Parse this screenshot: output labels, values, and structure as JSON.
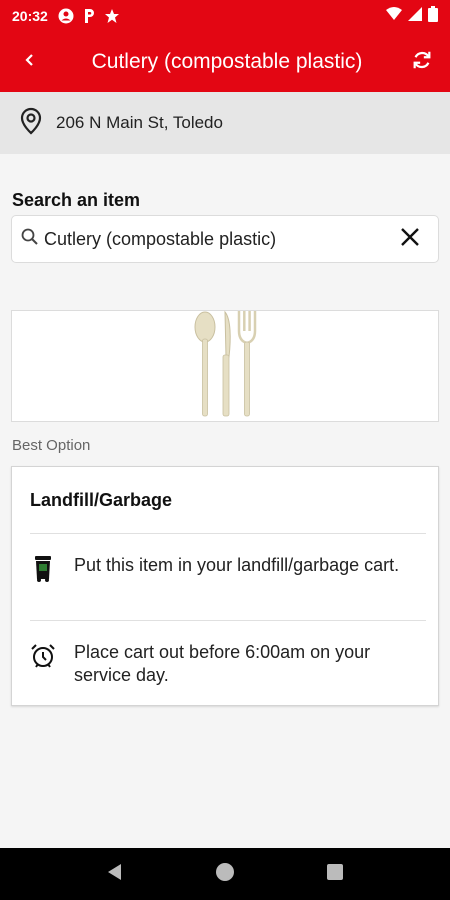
{
  "status_bar": {
    "time": "20:32",
    "icons": [
      "account-circle-icon",
      "p-icon",
      "star-icon",
      "wifi-icon",
      "signal-icon",
      "battery-icon"
    ]
  },
  "app_bar": {
    "title": "Cutlery (compostable plastic)",
    "back_icon": "chevron-left-icon",
    "refresh_icon": "refresh-icon"
  },
  "location": {
    "icon": "location-pin-icon",
    "address": "206 N Main St, Toledo"
  },
  "search": {
    "label": "Search an item",
    "value": "Cutlery (compostable plastic)",
    "icon": "search-icon",
    "clear_icon": "close-icon"
  },
  "item_image": {
    "icon": "cutlery-image"
  },
  "best_option": {
    "label": "Best Option",
    "title": "Landfill/Garbage",
    "instructions": [
      {
        "icon": "garbage-cart-icon",
        "text": "Put this item in your landfill/garbage cart."
      },
      {
        "icon": "alarm-clock-icon",
        "text": "Place cart out before 6:00am on your service day."
      }
    ]
  },
  "nav_bar": {
    "icons": [
      "back-triangle-icon",
      "home-circle-icon",
      "recents-square-icon"
    ]
  },
  "colors": {
    "brand_red": "#e30613",
    "address_bg": "#e6e6e6",
    "page_bg": "#f5f5f5"
  }
}
